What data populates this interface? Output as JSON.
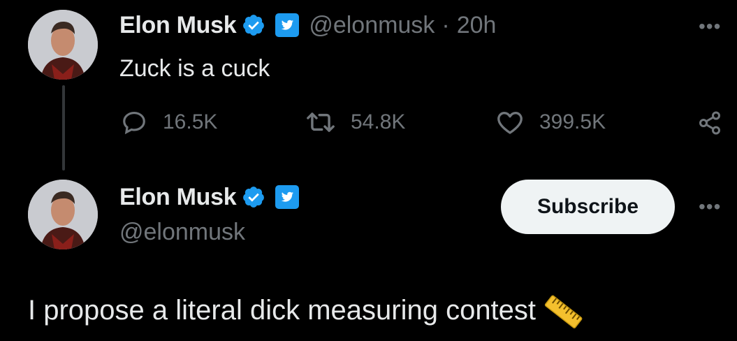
{
  "tweet1": {
    "author_name": "Elon Musk",
    "handle": "@elonmusk",
    "time_sep": "·",
    "time": "20h",
    "text": "Zuck is a cuck",
    "more": "•••",
    "metrics": {
      "replies": "16.5K",
      "retweets": "54.8K",
      "likes": "399.5K"
    }
  },
  "tweet2": {
    "author_name": "Elon Musk",
    "handle": "@elonmusk",
    "subscribe_label": "Subscribe",
    "more": "•••",
    "text": "I propose a literal dick measuring contest",
    "emoji": "📏"
  },
  "colors": {
    "background": "#000000",
    "text_primary": "#e7e9ea",
    "text_secondary": "#71767b",
    "verified_blue": "#1d9bf0",
    "subscribe_bg": "#eff3f4"
  },
  "icons": [
    "verified-badge-icon",
    "twitter-bird-badge-icon",
    "reply-icon",
    "retweet-icon",
    "like-icon",
    "share-icon",
    "more-icon",
    "ruler-emoji-icon"
  ]
}
